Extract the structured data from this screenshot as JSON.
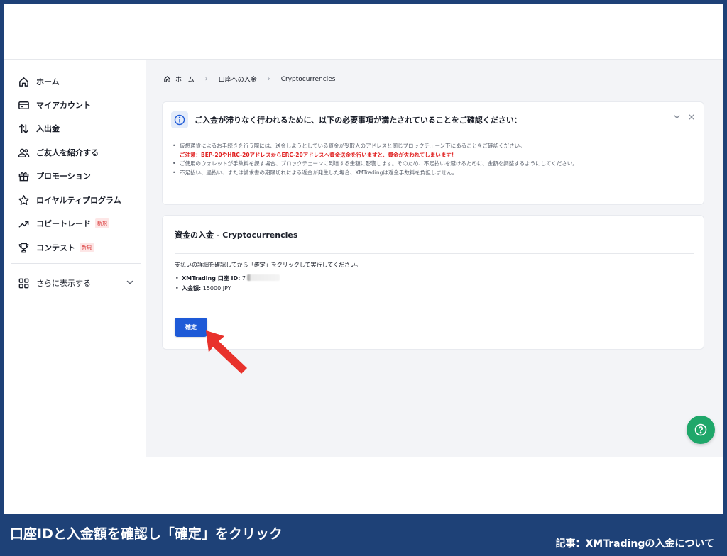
{
  "colors": {
    "frame_border": "#1e4177",
    "primary_button": "#1e5ad7",
    "warning_text": "#e02020",
    "help_button": "#1fa76a",
    "annotation_arrow": "#e8322c",
    "badge_text": "#d93a3a"
  },
  "sidebar": {
    "items": [
      {
        "label": "ホーム",
        "icon": "home-icon"
      },
      {
        "label": "マイアカウント",
        "icon": "credit-card-icon"
      },
      {
        "label": "入出金",
        "icon": "swap-arrows-icon"
      },
      {
        "label": "ご友人を紹介する",
        "icon": "users-icon"
      },
      {
        "label": "プロモーション",
        "icon": "gift-icon"
      },
      {
        "label": "ロイヤルティプログラム",
        "icon": "star-icon"
      },
      {
        "label": "コピートレード",
        "icon": "trend-up-icon",
        "badge": "新規"
      },
      {
        "label": "コンテスト",
        "icon": "trophy-icon",
        "badge": "新規"
      }
    ],
    "more_label": "さらに表示する"
  },
  "breadcrumb": {
    "home": "ホーム",
    "deposit": "口座への入金",
    "current": "Cryptocurrencies"
  },
  "notice": {
    "title": "ご入金が滞りなく行われるために、以下の必要事項が満たされていることをご確認ください：",
    "items": [
      "仮想通貨によるお手続きを行う際には、送金しようとしている資金が受取人のアドレスと同じブロックチェーン下にあることをご確認ください。",
      "ご使用のウォレットが手数料を課す場合、ブロックチェーンに到達する金額に影響します。そのため、不足払いを避けるために、金額を調整するようにしてください。",
      "不足払い、過払い、または請求書の期限切れによる返金が発生した場合、XMTradingは返金手数料を負担しません。"
    ],
    "warning": "ご注意：BEP-20やHRC-20アドレスからERC-20アドレスへ資金送金を行いますと、資金が失われてしまいます！"
  },
  "deposit": {
    "title": "資金の入金 - Cryptocurrencies",
    "instruction": "支払いの詳細を確認してから「確定」をクリックして実行してください。",
    "account_id_label": "XMTrading 口座 ID:",
    "account_id_prefix": "7",
    "amount_label": "入金額:",
    "amount_value": "15000 JPY",
    "confirm_label": "確定"
  },
  "caption": {
    "left": "口座IDと入金額を確認し「確定」をクリック",
    "right": "記事：XMTradingの入金について"
  }
}
